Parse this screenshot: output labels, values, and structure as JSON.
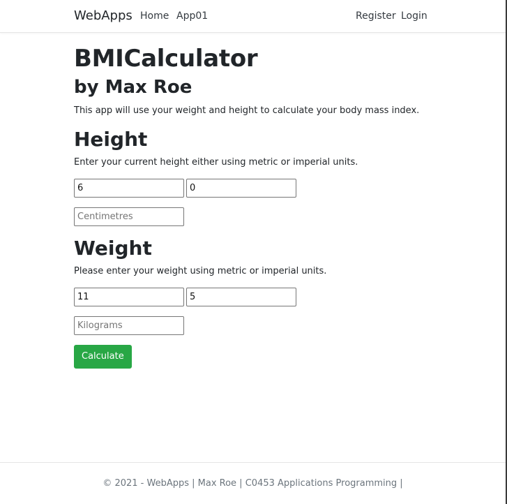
{
  "navbar": {
    "brand": "WebApps",
    "links": [
      "Home",
      "App01"
    ],
    "right_links": [
      "Register",
      "Login"
    ]
  },
  "main": {
    "title": "BMICalculator",
    "subtitle": "by Max Roe",
    "description": "This app will use your weight and height to calculate your body mass index.",
    "height": {
      "heading": "Height",
      "instructions": "Enter your current height either using metric or imperial units.",
      "feet_value": "6",
      "inches_value": "0",
      "centimetres_placeholder": "Centimetres"
    },
    "weight": {
      "heading": "Weight",
      "instructions": "Please enter your weight using metric or imperial units.",
      "stones_value": "11",
      "pounds_value": "5",
      "kilograms_placeholder": "Kilograms"
    },
    "calculate_label": "Calculate"
  },
  "footer": {
    "text": "© 2021 - WebApps | Max Roe | C0453 Applications Programming |"
  },
  "colors": {
    "button": "#28a745",
    "footer_text": "#6c757d"
  }
}
